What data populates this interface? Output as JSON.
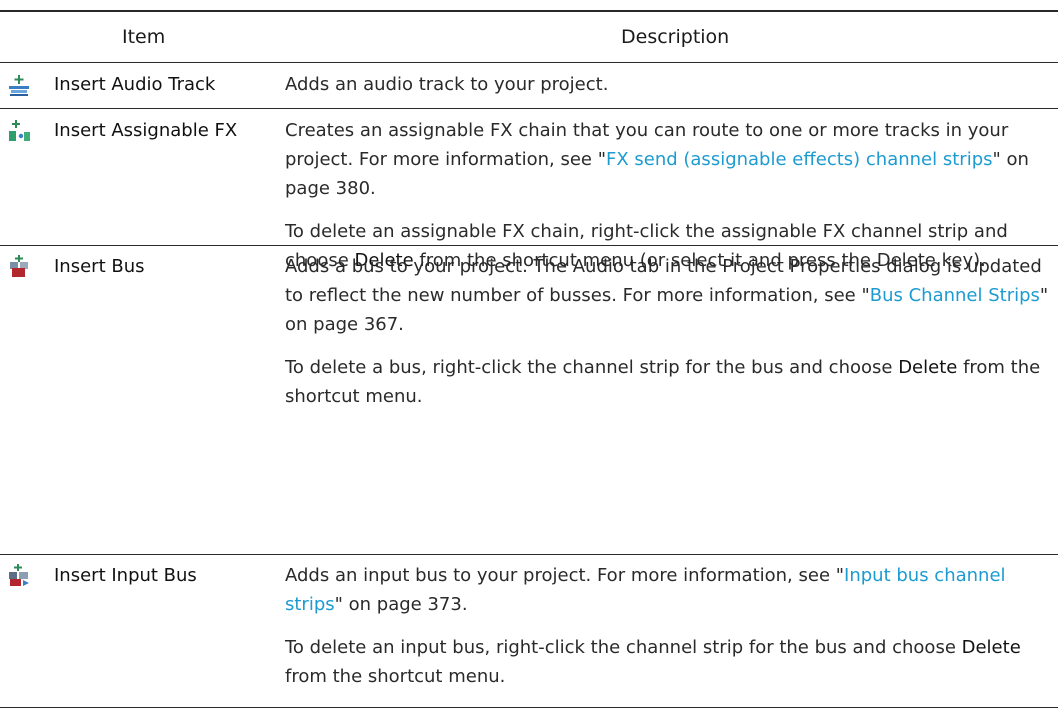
{
  "table": {
    "columns": [
      "Item",
      "Description"
    ],
    "rows": [
      {
        "icon": "insert-audio-track-icon",
        "item": "Insert Audio Track",
        "paragraphs": [
          {
            "text": "Adds an audio track to your project."
          }
        ]
      },
      {
        "icon": "insert-assignable-fx-icon",
        "item": "Insert Assignable FX",
        "paragraphs": [
          {
            "pre": "Creates an assignable FX chain that you can route to one or more tracks in your project. For more information, see \"",
            "link": "FX send (assignable effects) channel strips",
            "post": "\" on page 380."
          },
          {
            "pre": "To delete an assignable FX chain, right-click the assignable FX channel strip and choose ",
            "kw": "Delete",
            "post": " from the shortcut menu (or select it and press the Delete key)."
          }
        ]
      },
      {
        "icon": "insert-bus-icon",
        "item": "Insert Bus",
        "paragraphs": [
          {
            "pre": "Adds a bus to your project. The Audio tab in the Project Properties dialog is updated to reflect the new number of busses. For more information, see \"",
            "link": "Bus Channel Strips",
            "post": "\" on page 367."
          },
          {
            "pre": "To delete a bus, right-click the channel strip for the bus and choose ",
            "kw": "Delete",
            "post": " from the shortcut menu."
          }
        ]
      },
      {
        "icon": "insert-input-bus-icon",
        "item": "Insert Input Bus",
        "paragraphs": [
          {
            "pre": "Adds an input bus to your project. For more information, see \"",
            "link": "Input bus channel strips",
            "post": "\" on page 373."
          },
          {
            "pre": "To delete an input bus, right-click the channel strip for the bus and choose ",
            "kw": "Delete",
            "post": " from the shortcut menu."
          }
        ]
      }
    ]
  }
}
